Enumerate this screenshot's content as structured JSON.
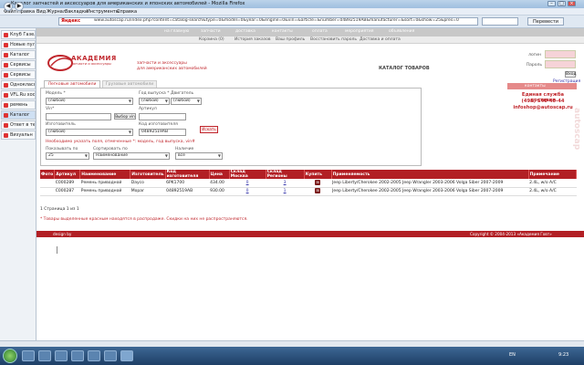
{
  "window": {
    "title": "Каталог запчастей и аксессуаров для американских и японских автомобилей - Mozilla Firefox",
    "min": "–",
    "max": "□",
    "close": "×"
  },
  "menu": [
    "Файл",
    "Правка",
    "Вид",
    "Журнал",
    "Закладки",
    "Инструменты",
    "Справка"
  ],
  "navbar": {
    "back": "◀",
    "forward": "▶",
    "yandex": "Яндекс",
    "url": "www.autoscap.ru/index.php?content=catalog-search&type=0&model=0&year=0&engine=0&vin=&article=&number=04892519AB&manufacturer=&sort=0&show=25&pres=0",
    "translate": "Перевести"
  },
  "tabs": [
    "Клуб Газель",
    "Новые пул",
    "Каталог",
    "Сервисы",
    "Сервисы",
    "Однокласс",
    "VFL.Ru хост",
    "ремень",
    "Каталог",
    "Ответ в те",
    "Визуальн"
  ],
  "site": {
    "topnav": [
      "на главную",
      "запчасти",
      "доставка",
      "контакты",
      "оплата",
      "мероприятия",
      "объявления"
    ],
    "subnav": [
      "Корзина (0)",
      "История заказов",
      "Ваш профиль",
      "Восстановить пароль",
      "Доставка и оплата"
    ],
    "logo": "АКАДЕМИЯ",
    "logo_sub": "запчасти и аксессуары",
    "tagline1": "запчасти и аксессуары",
    "tagline2": "для американских автомобилей",
    "catalog_title": "КАТАЛОГ ТОВАРОВ",
    "login": {
      "login_label": "логин",
      "password_label": "Пароль",
      "button": "Вход",
      "register": "Регистрация"
    },
    "contacts_bar": "контакты",
    "service": {
      "title": "Единая служба доставки",
      "phone": "(495) 540-40-44",
      "email": "infoshop@autoscap.ru"
    },
    "watermark": "autoscap"
  },
  "search": {
    "tab_cars": "Легковые автомобили",
    "tab_trucks": "Грузовые автомобили",
    "model_label": "Модель *",
    "model_value": "(любой)",
    "year_label": "Год выпуска *",
    "year_value": "(любой)",
    "engine_label": "Двигатель",
    "engine_value": "(любой)",
    "vin_label": "Vin*",
    "vin_button": "Выбор vin",
    "article_label": "Артикул",
    "manufacturer_label": "Изготовитель",
    "manufacturer_value": "(любой)",
    "number_label": "Код изготовителя",
    "number_value": "04892519AB",
    "search_button": "Искать",
    "required_note": "Необходимо указать поля, отмеченные *: модель, год выпуска, vin#",
    "show_label": "Показывать по",
    "show_value": "25",
    "sort_label": "Сортировать по",
    "sort_value": "Наименование",
    "presence_label": "Наличие",
    "presence_value": "все"
  },
  "results": {
    "headers": [
      "Фото",
      "Артикул",
      "Наименование",
      "Изготовитель",
      "Код изготовителя",
      "Цена",
      "Склад Москва",
      "Склад Регионы",
      "Купить",
      "Применяемость",
      "Примечание"
    ],
    "rows": [
      {
        "photo": "",
        "article": "C000289",
        "name": "Ремень приводной",
        "maker": "Dayco",
        "code": "6PK1700",
        "price": "434.00",
        "stock_msk": "0",
        "stock_reg": "3",
        "buy": "⊞",
        "fitment": "Jeep Liberty/Cherokee 2002-2005 Jeep Wrangler 2003-2006 Volga Siber 2007-2009",
        "note": "2.4L, w/o A/C"
      },
      {
        "photo": "",
        "article": "C000287",
        "name": "Ремень приводной",
        "maker": "Mopar",
        "code": "04892519AB",
        "price": "930.00",
        "stock_msk": "0",
        "stock_reg": "1",
        "buy": "⊞",
        "fitment": "Jeep Liberty/Cherokee 2002-2005 Jeep Wrangler 2003-2006 Volga Siber 2007-2009",
        "note": "2.4L, w/o A/C"
      }
    ],
    "pager": "1 Страница 1 из 1",
    "sale_note": "* Товары выделенные красным находятся в распродаже. Скидки на них не распространяются."
  },
  "footer": {
    "design": "design by",
    "copyright": "Copyright © 2004-2013 «Академия Говт»"
  },
  "taskbar": {
    "lang": "EN",
    "time": "9:23"
  }
}
